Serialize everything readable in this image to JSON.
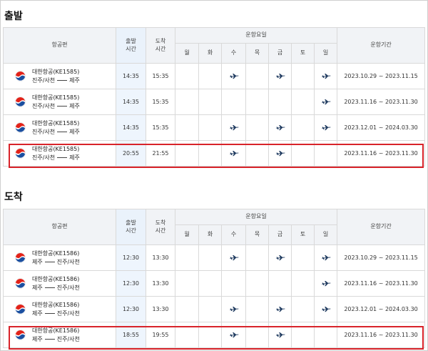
{
  "sections": [
    {
      "title": "출발",
      "headers": {
        "airline": "항공편",
        "dep_time": "출발\n시간",
        "arr_time": "도착\n시간",
        "days_group": "운항요일",
        "days": [
          "월",
          "화",
          "수",
          "목",
          "금",
          "토",
          "일"
        ],
        "period": "운항기간"
      },
      "rows": [
        {
          "airline": "대한항공(KE1585)",
          "from": "진주/사천",
          "to": "제주",
          "dep": "14:35",
          "arr": "15:35",
          "days": [
            false,
            false,
            true,
            false,
            true,
            false,
            true
          ],
          "period": "2023.10.29 ~ 2023.11.15"
        },
        {
          "airline": "대한항공(KE1585)",
          "from": "진주/사천",
          "to": "제주",
          "dep": "14:35",
          "arr": "15:35",
          "days": [
            false,
            false,
            false,
            false,
            false,
            false,
            true
          ],
          "period": "2023.11.16 ~ 2023.11.30"
        },
        {
          "airline": "대한항공(KE1585)",
          "from": "진주/사천",
          "to": "제주",
          "dep": "14:35",
          "arr": "15:35",
          "days": [
            false,
            false,
            true,
            false,
            true,
            false,
            true
          ],
          "period": "2023.12.01 ~ 2024.03.30"
        },
        {
          "airline": "대한항공(KE1585)",
          "from": "진주/사천",
          "to": "제주",
          "dep": "20:55",
          "arr": "21:55",
          "days": [
            false,
            false,
            true,
            false,
            true,
            false,
            false
          ],
          "period": "2023.11.16 ~ 2023.11.30"
        }
      ]
    },
    {
      "title": "도착",
      "headers": {
        "airline": "항공편",
        "dep_time": "출발\n시간",
        "arr_time": "도착\n시간",
        "days_group": "운항요일",
        "days": [
          "월",
          "화",
          "수",
          "목",
          "금",
          "토",
          "일"
        ],
        "period": "운항기간"
      },
      "rows": [
        {
          "airline": "대한항공(KE1586)",
          "from": "제주",
          "to": "진주/사천",
          "dep": "12:30",
          "arr": "13:30",
          "days": [
            false,
            false,
            true,
            false,
            true,
            false,
            true
          ],
          "period": "2023.10.29 ~ 2023.11.15"
        },
        {
          "airline": "대한항공(KE1586)",
          "from": "제주",
          "to": "진주/사천",
          "dep": "12:30",
          "arr": "13:30",
          "days": [
            false,
            false,
            false,
            false,
            false,
            false,
            true
          ],
          "period": "2023.11.16 ~ 2023.11.30"
        },
        {
          "airline": "대한항공(KE1586)",
          "from": "제주",
          "to": "진주/사천",
          "dep": "12:30",
          "arr": "13:30",
          "days": [
            false,
            false,
            true,
            false,
            true,
            false,
            true
          ],
          "period": "2023.12.01 ~ 2024.03.30"
        },
        {
          "airline": "대한항공(KE1586)",
          "from": "제주",
          "to": "진주/사천",
          "dep": "18:55",
          "arr": "19:55",
          "days": [
            false,
            false,
            true,
            false,
            true,
            false,
            false
          ],
          "period": "2023.11.16 ~ 2023.11.30"
        }
      ]
    }
  ],
  "icons": {
    "airline_logo": "korean-air-logo",
    "operating_day": "airplane-icon"
  },
  "colors": {
    "highlight": "#d8232a",
    "header_bg": "#f1f3f6",
    "dep_column_bg": "#eef5fd",
    "plane": "#1f3a5f",
    "logo_red": "#e2231a",
    "logo_blue": "#1b4fa0"
  }
}
